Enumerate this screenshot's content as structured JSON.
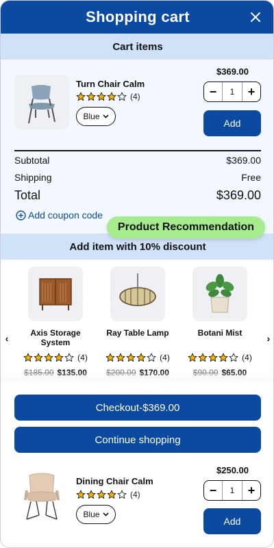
{
  "header": {
    "title": "Shopping cart"
  },
  "cart_section": {
    "label": "Cart items"
  },
  "cart_item": {
    "name": "Turn Chair Calm",
    "rating": 4,
    "rating_count": "(4)",
    "color": "Blue",
    "price": "$369.00",
    "quantity": "1",
    "add_label": "Add"
  },
  "summary": {
    "subtotal_label": "Subtotal",
    "subtotal_value": "$369.00",
    "shipping_label": "Shipping",
    "shipping_value": "Free",
    "total_label": "Total",
    "total_value": "$369.00"
  },
  "coupon": {
    "label": "Add coupon code"
  },
  "recommendation": {
    "tooltip": "Product Recommendation",
    "band_label": "Add item with 10% discount",
    "items": [
      {
        "name": "Axis Storage System",
        "rating": 4,
        "rating_count": "(4)",
        "old_price": "$185.00",
        "new_price": "$135.00"
      },
      {
        "name": "Ray Table Lamp",
        "rating": 4,
        "rating_count": "(4)",
        "old_price": "$200.00",
        "new_price": "$170.00"
      },
      {
        "name": "Botani Mist",
        "rating": 4,
        "rating_count": "(4)",
        "old_price": "$90.00",
        "new_price": "$65.00"
      }
    ]
  },
  "actions": {
    "checkout_label": "Checkout-$369.00",
    "continue_label": "Continue shopping"
  },
  "bottom_item": {
    "name": "Dining Chair Calm",
    "rating": 4,
    "rating_count": "(4)",
    "color": "Blue",
    "price": "$250.00",
    "quantity": "1",
    "add_label": "Add"
  },
  "colors": {
    "primary": "#0b4aa0",
    "band": "#cfe2f8",
    "tooltip": "#a6ec8f",
    "star": "#f4b400"
  }
}
